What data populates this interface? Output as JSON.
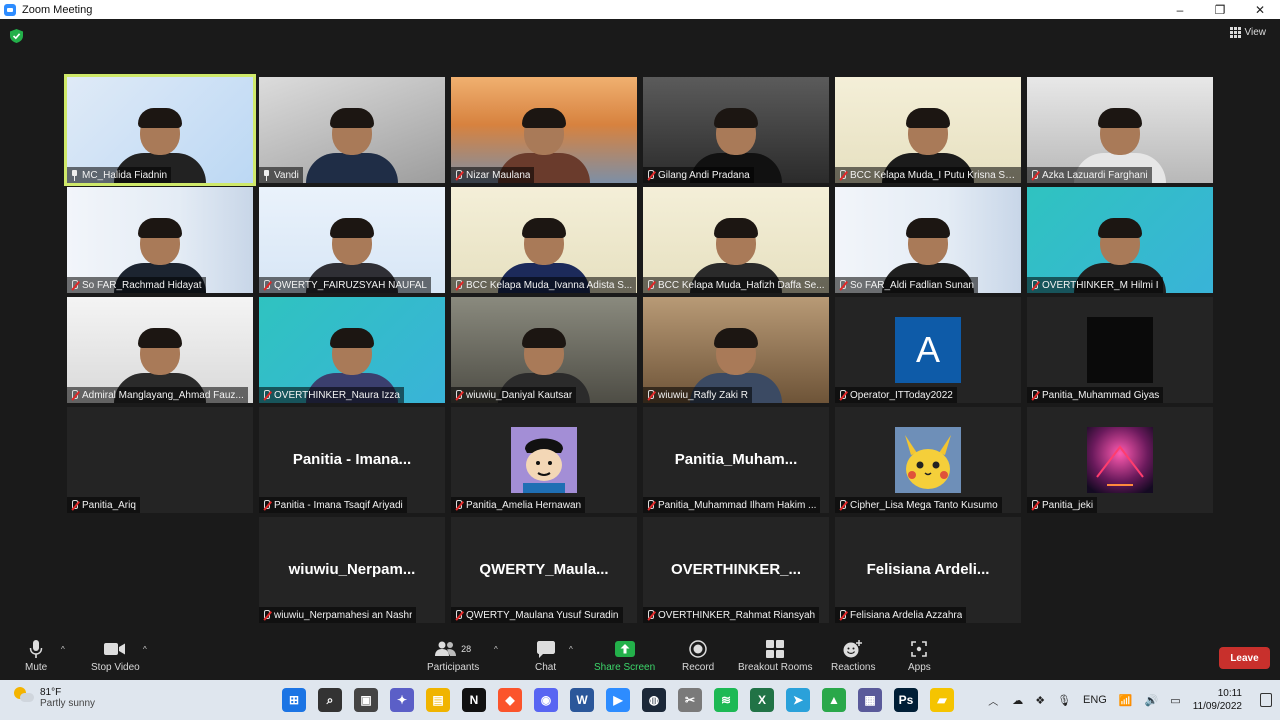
{
  "window": {
    "title": "Zoom Meeting",
    "minimize": "–",
    "maximize": "❐",
    "close": "✕"
  },
  "view_label": "View",
  "tiles": [
    {
      "name": "MC_Halida Fiadnin",
      "type": "video",
      "pinned": true
    },
    {
      "name": "Vandi",
      "type": "video",
      "pinned": true
    },
    {
      "name": "Nizar Maulana",
      "type": "video"
    },
    {
      "name": "Gilang Andi Pradana",
      "type": "video"
    },
    {
      "name": "BCC Kelapa Muda_I Putu Krisna Se...",
      "type": "video"
    },
    {
      "name": "Azka Lazuardi Farghani",
      "type": "video"
    },
    {
      "name": "So FAR_Rachmad Hidayat",
      "type": "video"
    },
    {
      "name": "QWERTY_FAIRUZSYAH NAUFAL",
      "type": "video"
    },
    {
      "name": "BCC Kelapa Muda_Ivanna Adista S...",
      "type": "video"
    },
    {
      "name": "BCC Kelapa Muda_Hafizh Daffa Se...",
      "type": "video"
    },
    {
      "name": "So FAR_Aldi Fadlian Sunan",
      "type": "video"
    },
    {
      "name": "OVERTHINKER_M Hilmi I",
      "type": "video"
    },
    {
      "name": "Admiral Manglayang_Ahmad Fauz...",
      "type": "video"
    },
    {
      "name": "OVERTHINKER_Naura Izza",
      "type": "video"
    },
    {
      "name": "wiuwiu_Daniyal Kautsar",
      "type": "video"
    },
    {
      "name": "wiuwiu_Rafly Zaki R",
      "type": "video"
    },
    {
      "name": "Operator_ITToday2022",
      "type": "avatar_letter",
      "letter": "A"
    },
    {
      "name": "Panitia_Muhammad Giyas",
      "type": "avatar_black"
    },
    {
      "name": "Panitia_Ariq",
      "type": "blank"
    },
    {
      "name": "Panitia - Imana Tsaqif Ariyadi",
      "type": "text",
      "big": "Panitia - Imana..."
    },
    {
      "name": "Panitia_Amelia Hernawan",
      "type": "avatar_cartoon"
    },
    {
      "name": "Panitia_Muhammad Ilham Hakim ...",
      "type": "text",
      "big": "Panitia_Muham..."
    },
    {
      "name": "Cipher_Lisa Mega Tanto Kusumo",
      "type": "avatar_pikachu"
    },
    {
      "name": "Panitia_jeki",
      "type": "avatar_neon"
    },
    {
      "name": "wiuwiu_Nerpamahesi an Nashr",
      "type": "text",
      "big": "wiuwiu_Nerpam..."
    },
    {
      "name": "QWERTY_Maulana Yusuf Suradin",
      "type": "text",
      "big": "QWERTY_Maula..."
    },
    {
      "name": "OVERTHINKER_Rahmat Riansyah",
      "type": "text",
      "big": "OVERTHINKER_..."
    },
    {
      "name": "Felisiana Ardelia Azzahra",
      "type": "text",
      "big": "Felisiana  Ardeli..."
    }
  ],
  "toolbar": {
    "mute": "Mute",
    "stop_video": "Stop Video",
    "participants": "Participants",
    "participants_count": "28",
    "chat": "Chat",
    "share_screen": "Share Screen",
    "record": "Record",
    "breakout_rooms": "Breakout Rooms",
    "reactions": "Reactions",
    "apps": "Apps",
    "leave": "Leave"
  },
  "taskbar": {
    "temperature": "81°F",
    "condition": "Partly sunny",
    "language": "ENG",
    "time": "10:11",
    "date": "11/09/2022",
    "apps": [
      "Start",
      "Search",
      "Task View",
      "Chat",
      "File Explorer",
      "Notion",
      "Brave",
      "Discord",
      "Word",
      "Zoom",
      "Steam",
      "Snipping Tool",
      "Spotify",
      "Excel",
      "Telegram",
      "Network",
      "VirtualBox",
      "Photoshop",
      "Sticky Notes"
    ]
  }
}
